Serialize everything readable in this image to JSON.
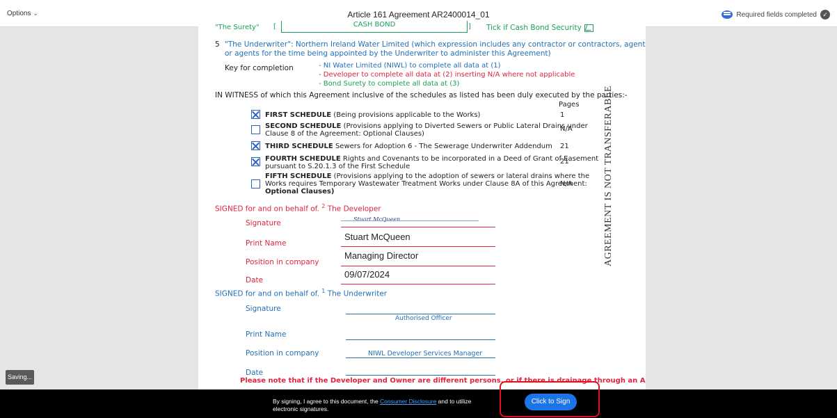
{
  "topbar": {
    "options_label": "Options",
    "title": "Article 161 Agreement AR2400014_01",
    "status": "Required fields completed"
  },
  "document": {
    "surety_label": "\"The Surety\"",
    "surety_value": "CASH BOND",
    "cash_bond_tick_label": "Tick if Cash Bond Security",
    "underwriter_num": "5",
    "underwriter_text_1": "\"The Underwriter\": Northern Ireland Water Limited (which expression includes any contractor or contractors, agent",
    "underwriter_text_2": "or agents for the time being appointed by the Underwriter to administer this Agreement)",
    "key_label": "Key for completion",
    "key_1": "- NI Water Limited (NIWL) to complete all data at (1)",
    "key_2": "- Developer to complete all data at (2) inserting N/A where not applicable",
    "key_3": "- Bond Surety to complete all data at (3)",
    "witness_text": "IN WITNESS of which this Agreement inclusive of the schedules as listed has been duly executed by the parties:-",
    "pages_header": "Pages",
    "schedules": [
      {
        "bold": "FIRST SCHEDULE",
        "text_1": " (Being provisions applicable to the Works)",
        "text_2": "",
        "text_3": "",
        "pages": "1",
        "checked": true
      },
      {
        "bold": "SECOND SCHEDULE",
        "text_1": " (Provisions applying to Diverted Sewers or Public Lateral Drains under",
        "text_2": "Clause 8 of the Agreement: Optional Clauses)",
        "text_3": "",
        "pages": "N/A",
        "checked": false
      },
      {
        "bold": "THIRD SCHEDULE",
        "text_1": " Sewers for Adoption 6 - The Sewerage Underwriter Addendum",
        "text_2": "",
        "text_3": "",
        "pages": "21",
        "checked": true
      },
      {
        "bold": "FOURTH SCHEDULE",
        "text_1": " Rights and Covenants to be incorporated in a Deed of Grant of Easement",
        "text_2": "pursuant to S.20.1.3 of the First Schedule",
        "text_3": "",
        "pages": "21",
        "checked": true
      },
      {
        "bold": "FIFTH SCHEDULE",
        "text_1": " (Provisions applying to the adoption of sewers or lateral drains where the",
        "text_2": "Works requires Temporary Wastewater Treatment Works under Clause 8A of this Agreement:",
        "text_3": "Optional Clauses)",
        "pages": "N/A",
        "checked": false
      }
    ],
    "developer_heading_prefix": "SIGNED for and on behalf of.",
    "developer_heading_sup": "2",
    "developer_heading_suffix": "The Developer",
    "developer": {
      "signature_label": "Signature",
      "signature_value": "Stuart McQueen",
      "print_name_label": "Print Name",
      "print_name_value": "Stuart McQueen",
      "position_label": "Position in company",
      "position_value": "Managing Director",
      "date_label": "Date",
      "date_value": "09/07/2024"
    },
    "underwriter_heading_prefix": "SIGNED for and on behalf of.",
    "underwriter_heading_sup": "1",
    "underwriter_heading_suffix": "The Underwriter",
    "underwriter": {
      "signature_label": "Signature",
      "signature_value": "Authorised Officer",
      "print_name_label": "Print Name",
      "position_label": "Position in company",
      "position_value": "NIWL Developer Services Manager",
      "date_label": "Date"
    },
    "note": "Please note that if the Developer and Owner are different persons, or if there is drainage through an Adjacent",
    "side_text": "AGREEMENT IS NOT TRANSFERABLE"
  },
  "saving_label": "Saving...",
  "footer": {
    "consent_prefix": "By signing, I agree to this document, the ",
    "consent_link": "Consumer Disclosure",
    "consent_suffix": " and to utilize electronic signatures.",
    "sign_button": "Click to Sign"
  },
  "colors": {
    "green": "#1aa05a",
    "blue": "#1f6fb7",
    "red": "#e0243f",
    "sign_button": "#1b74e8",
    "highlight": "#e0101c"
  },
  "icons": [
    "chevron-down-icon",
    "comment-icon",
    "checkmark-circle-icon",
    "checkbox-icon"
  ]
}
